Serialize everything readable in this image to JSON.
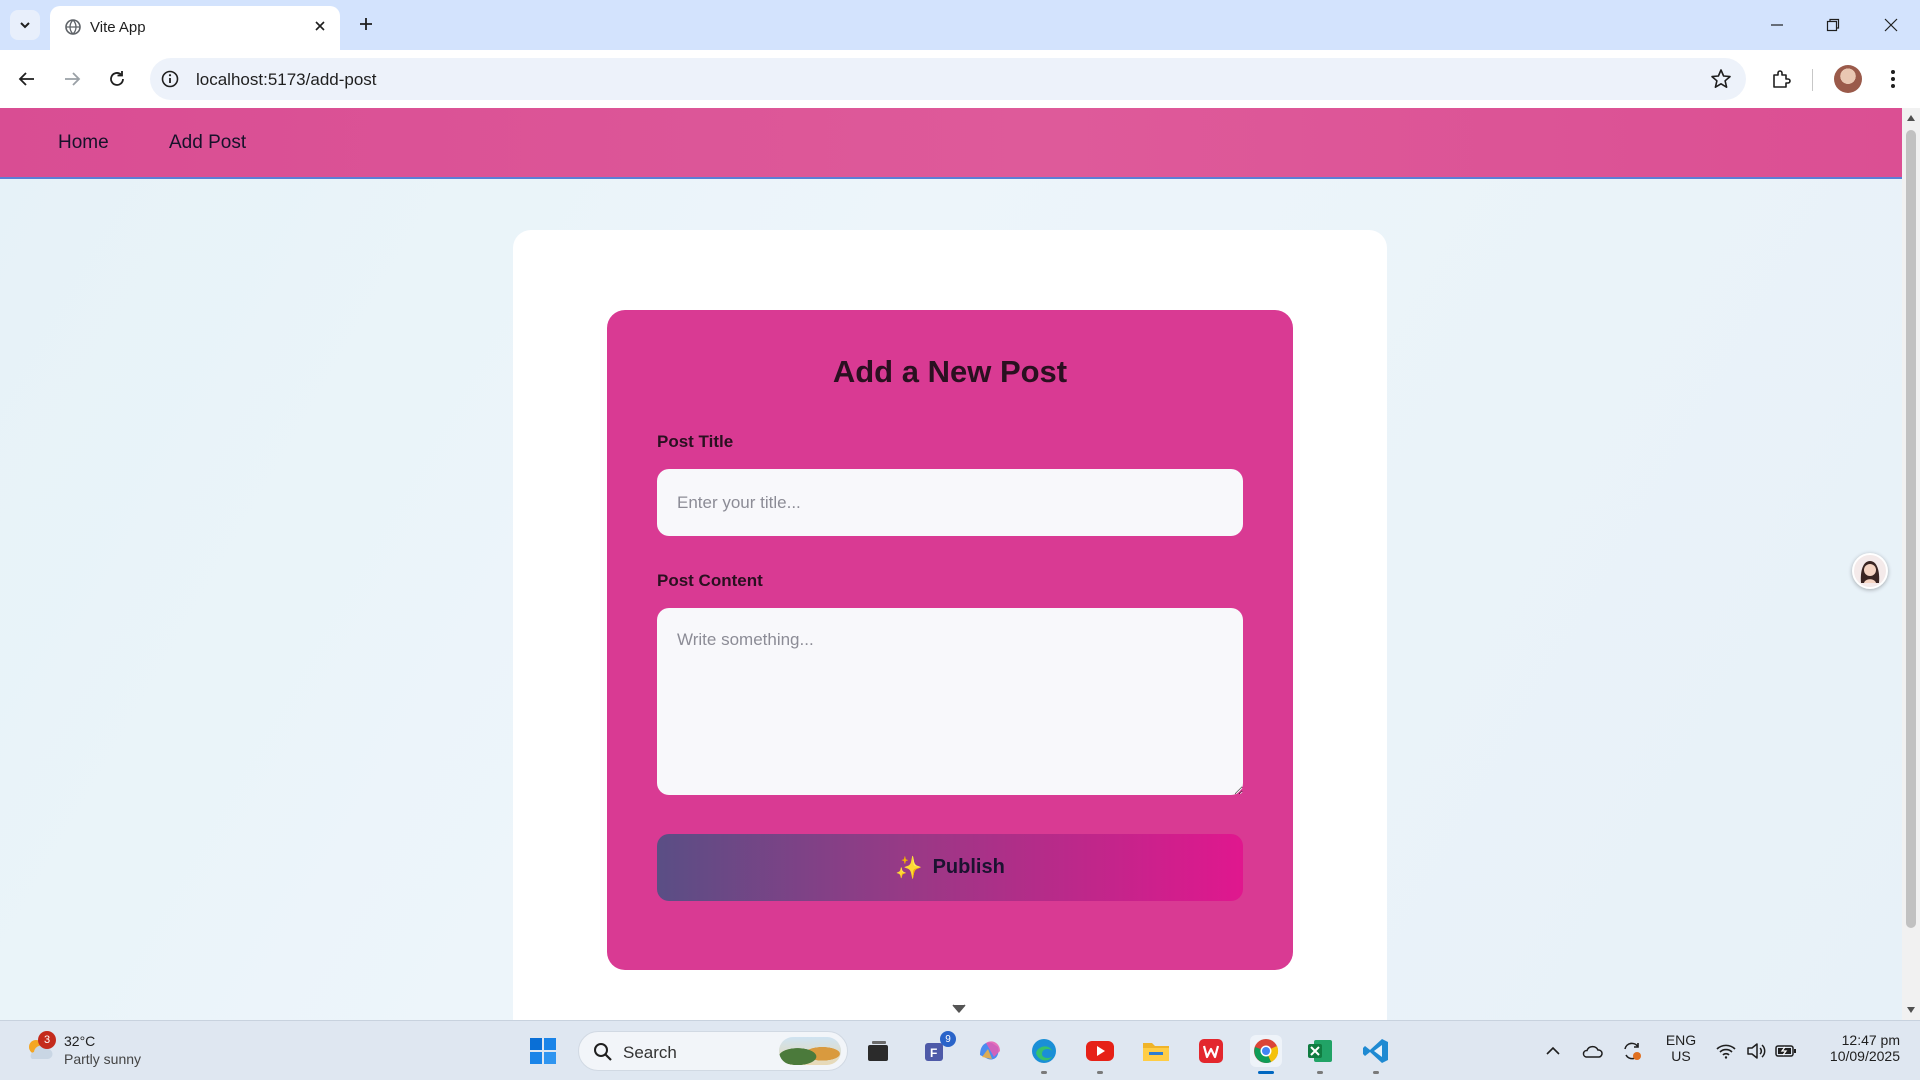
{
  "browser": {
    "tab_title": "Vite App",
    "url": "localhost:5173/add-post"
  },
  "app": {
    "nav": {
      "home": "Home",
      "add_post": "Add Post"
    },
    "form": {
      "title": "Add a New Post",
      "title_label": "Post Title",
      "title_placeholder": "Enter your title...",
      "content_label": "Post Content",
      "content_placeholder": "Write something...",
      "publish_icon": "✨",
      "publish_label": "Publish"
    }
  },
  "taskbar": {
    "weather": {
      "badge": "3",
      "temp": "32°C",
      "desc": "Partly sunny"
    },
    "search_label": "Search",
    "teams_badge": "9",
    "lang_top": "ENG",
    "lang_bottom": "US",
    "time": "12:47 pm",
    "date": "10/09/2025"
  },
  "colors": {
    "nav_bar": "#db5297",
    "form_card": "#d93a93",
    "publish_start": "#5a4e85",
    "publish_end": "#e0178e",
    "page_bg": "#e9f3f8"
  }
}
